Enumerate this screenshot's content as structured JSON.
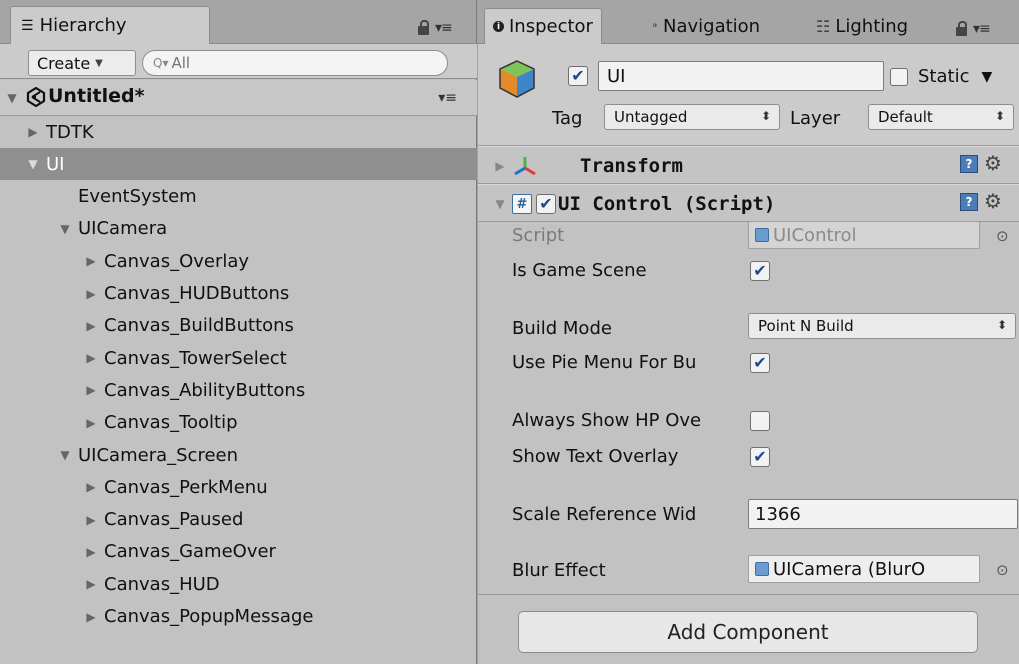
{
  "hierarchy": {
    "tab_label": "Hierarchy",
    "create_label": "Create",
    "search_placeholder": "All",
    "scene_name": "Untitled*",
    "items": [
      {
        "label": "TDTK",
        "fold": "closed",
        "level": 0,
        "selected": false
      },
      {
        "label": "UI",
        "fold": "open",
        "level": 0,
        "selected": true
      },
      {
        "label": "EventSystem",
        "fold": "none",
        "level": 1,
        "selected": false
      },
      {
        "label": "UICamera",
        "fold": "open",
        "level": 1,
        "selected": false
      },
      {
        "label": "Canvas_Overlay",
        "fold": "closed",
        "level": 2,
        "selected": false
      },
      {
        "label": "Canvas_HUDButtons",
        "fold": "closed",
        "level": 2,
        "selected": false
      },
      {
        "label": "Canvas_BuildButtons",
        "fold": "closed",
        "level": 2,
        "selected": false
      },
      {
        "label": "Canvas_TowerSelect",
        "fold": "closed",
        "level": 2,
        "selected": false
      },
      {
        "label": "Canvas_AbilityButtons",
        "fold": "closed",
        "level": 2,
        "selected": false
      },
      {
        "label": "Canvas_Tooltip",
        "fold": "closed",
        "level": 2,
        "selected": false
      },
      {
        "label": "UICamera_Screen",
        "fold": "open",
        "level": 1,
        "selected": false
      },
      {
        "label": "Canvas_PerkMenu",
        "fold": "closed",
        "level": 2,
        "selected": false
      },
      {
        "label": "Canvas_Paused",
        "fold": "closed",
        "level": 2,
        "selected": false
      },
      {
        "label": "Canvas_GameOver",
        "fold": "closed",
        "level": 2,
        "selected": false
      },
      {
        "label": "Canvas_HUD",
        "fold": "closed",
        "level": 2,
        "selected": false
      },
      {
        "label": "Canvas_PopupMessage",
        "fold": "closed",
        "level": 2,
        "selected": false
      }
    ]
  },
  "inspector": {
    "tabs": [
      "Inspector",
      "Navigation",
      "Lighting"
    ],
    "object_name": "UI",
    "active": true,
    "static_label": "Static",
    "static_checked": false,
    "tag_label": "Tag",
    "tag_value": "Untagged",
    "layer_label": "Layer",
    "layer_value": "Default",
    "transform_title": "Transform",
    "script_component_title": "UI Control (Script)",
    "props": {
      "script_label": "Script",
      "script_value": "UIControl",
      "is_game_scene_label": "Is Game Scene",
      "is_game_scene": true,
      "build_mode_label": "Build Mode",
      "build_mode_value": "Point N Build",
      "use_pie_label": "Use Pie Menu For Bu",
      "use_pie": true,
      "always_hp_label": "Always Show HP Ove",
      "always_hp": false,
      "show_text_label": "Show Text Overlay",
      "show_text": true,
      "scale_ref_label": "Scale Reference Wid",
      "scale_ref_value": "1366",
      "blur_label": "Blur Effect",
      "blur_value": "UICamera (BlurO"
    },
    "add_component_label": "Add Component"
  },
  "colors": {
    "panel": "#c2c2c2",
    "selection": "#8f8f8f",
    "accent_blue": "#4d7db8"
  }
}
